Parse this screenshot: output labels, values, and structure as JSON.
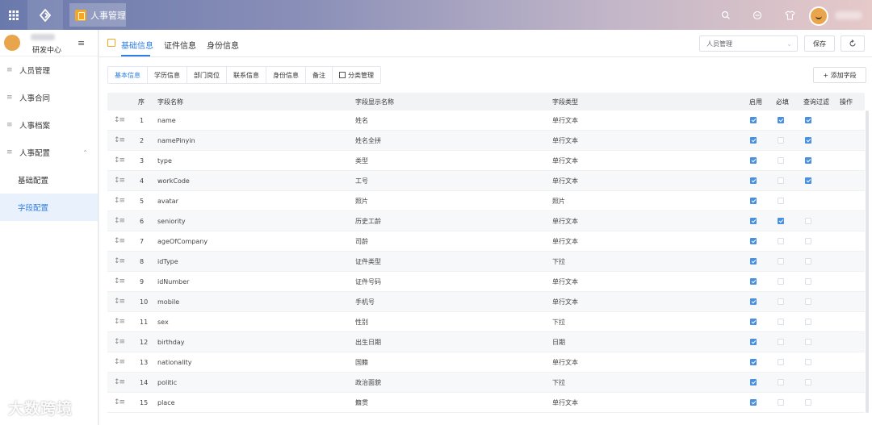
{
  "topbar": {
    "tab_label": "人事管理"
  },
  "sidebar": {
    "dept": "研发中心",
    "items": [
      {
        "label": "人员管理"
      },
      {
        "label": "人事合同"
      },
      {
        "label": "人事档案"
      },
      {
        "label": "人事配置"
      }
    ],
    "sub_items": [
      {
        "label": "基础配置"
      },
      {
        "label": "字段配置"
      }
    ]
  },
  "main": {
    "tabs": [
      {
        "label": "基础信息"
      },
      {
        "label": "证件信息"
      },
      {
        "label": "身份信息"
      }
    ],
    "select_value": "人员管理",
    "save_label": "保存",
    "sub_tabs": [
      {
        "label": "基本信息"
      },
      {
        "label": "学历信息"
      },
      {
        "label": "部门岗位"
      },
      {
        "label": "联系信息"
      },
      {
        "label": "身份信息"
      },
      {
        "label": "备注"
      },
      {
        "label": "分类管理"
      }
    ],
    "add_field_label": "+ 添加字段"
  },
  "table": {
    "headers": {
      "index": "序",
      "name": "字段名称",
      "display": "字段显示名称",
      "type": "字段类型",
      "enabled": "启用",
      "required": "必填",
      "filter": "查询过滤",
      "action": "操作"
    },
    "rows": [
      {
        "no": "1",
        "name": "name",
        "display": "姓名",
        "type": "单行文本",
        "enabled": true,
        "required": true,
        "filter": true
      },
      {
        "no": "2",
        "name": "namePinyin",
        "display": "姓名全拼",
        "type": "单行文本",
        "enabled": true,
        "required": false,
        "filter": true
      },
      {
        "no": "3",
        "name": "type",
        "display": "类型",
        "type": "单行文本",
        "enabled": true,
        "required": false,
        "filter": true
      },
      {
        "no": "4",
        "name": "workCode",
        "display": "工号",
        "type": "单行文本",
        "enabled": true,
        "required": false,
        "filter": true
      },
      {
        "no": "5",
        "name": "avatar",
        "display": "照片",
        "type": "照片",
        "enabled": true,
        "required": false,
        "filter": null
      },
      {
        "no": "6",
        "name": "seniority",
        "display": "历史工龄",
        "type": "单行文本",
        "enabled": true,
        "required": true,
        "filter": false
      },
      {
        "no": "7",
        "name": "ageOfCompany",
        "display": "司龄",
        "type": "单行文本",
        "enabled": true,
        "required": false,
        "filter": false
      },
      {
        "no": "8",
        "name": "idType",
        "display": "证件类型",
        "type": "下拉",
        "enabled": true,
        "required": false,
        "filter": false
      },
      {
        "no": "9",
        "name": "idNumber",
        "display": "证件号码",
        "type": "单行文本",
        "enabled": true,
        "required": false,
        "filter": false
      },
      {
        "no": "10",
        "name": "mobile",
        "display": "手机号",
        "type": "单行文本",
        "enabled": true,
        "required": false,
        "filter": false
      },
      {
        "no": "11",
        "name": "sex",
        "display": "性别",
        "type": "下拉",
        "enabled": true,
        "required": false,
        "filter": false
      },
      {
        "no": "12",
        "name": "birthday",
        "display": "出生日期",
        "type": "日期",
        "enabled": true,
        "required": false,
        "filter": false
      },
      {
        "no": "13",
        "name": "nationality",
        "display": "国籍",
        "type": "单行文本",
        "enabled": true,
        "required": false,
        "filter": false
      },
      {
        "no": "14",
        "name": "politic",
        "display": "政治面貌",
        "type": "下拉",
        "enabled": true,
        "required": false,
        "filter": false
      },
      {
        "no": "15",
        "name": "place",
        "display": "籍贯",
        "type": "单行文本",
        "enabled": true,
        "required": false,
        "filter": false
      }
    ]
  },
  "watermark": "大数跨境",
  "colors": {
    "accent": "#2f7de1",
    "checkbox": "#4a90e2",
    "topbar_start": "#6a79ac",
    "topbar_end": "#e6c9c9"
  }
}
